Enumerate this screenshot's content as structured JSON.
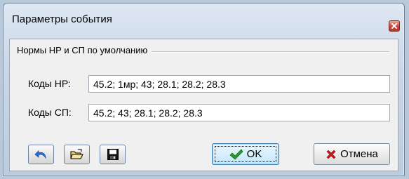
{
  "window": {
    "title": "Параметры события",
    "close_icon": "close-icon"
  },
  "group": {
    "label": "Нормы НР и СП по умолчанию"
  },
  "fields": {
    "nr_label": "Коды НР:",
    "nr_value": "45.2; 1мр; 43; 28.1; 28.2; 28.3",
    "sp_label": "Коды СП:",
    "sp_value": "45.2; 43; 28.1; 28.2; 28.3"
  },
  "toolbar": {
    "undo_icon": "undo-icon",
    "open_icon": "open-folder-icon",
    "save_icon": "floppy-disk-icon"
  },
  "buttons": {
    "ok_label": "OK",
    "cancel_label": "Отмена"
  },
  "colors": {
    "ok_check": "#2e9a2e",
    "cancel_x": "#cc1a1a",
    "undo_arrow": "#2f6fd6"
  }
}
